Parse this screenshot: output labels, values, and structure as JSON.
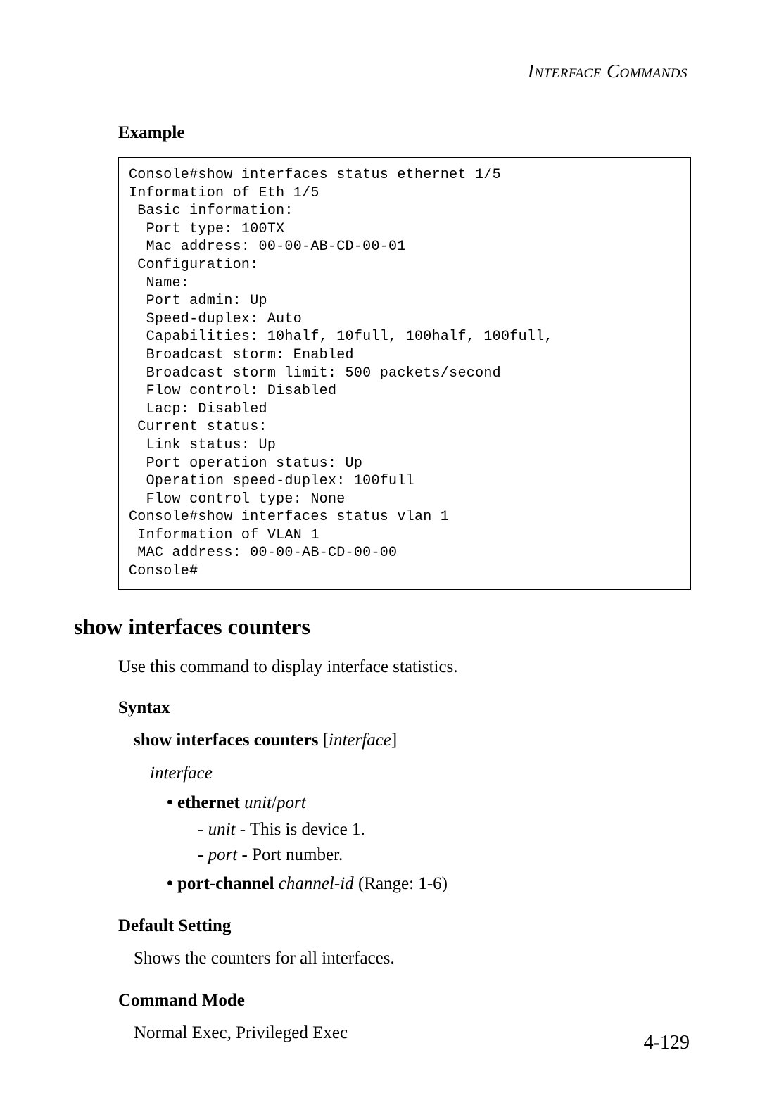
{
  "running_head": "Interface Commands",
  "example_heading": "Example",
  "console_output": "Console#show interfaces status ethernet 1/5\nInformation of Eth 1/5\n Basic information:\n  Port type: 100TX\n  Mac address: 00-00-AB-CD-00-01\n Configuration:\n  Name:\n  Port admin: Up\n  Speed-duplex: Auto\n  Capabilities: 10half, 10full, 100half, 100full,\n  Broadcast storm: Enabled\n  Broadcast storm limit: 500 packets/second\n  Flow control: Disabled\n  Lacp: Disabled\n Current status:\n  Link status: Up\n  Port operation status: Up\n  Operation speed-duplex: 100full\n  Flow control type: None\nConsole#show interfaces status vlan 1\n Information of VLAN 1\n MAC address: 00-00-AB-CD-00-00\nConsole#",
  "section_title": "show interfaces counters",
  "description": "Use this command to display interface statistics.",
  "syntax_heading": "Syntax",
  "syntax": {
    "cmd_bold": "show interfaces counters",
    "open_bracket": " [",
    "param_italic": "interface",
    "close_bracket": "]",
    "interface_label": "interface",
    "ethernet": {
      "kw": "ethernet",
      "args": "unit",
      "slash": "/",
      "args2": "port",
      "unit_label": "unit",
      "unit_desc": " - This is device 1.",
      "port_label": "port",
      "port_desc": " - Port number."
    },
    "portchannel": {
      "kw": "port-channel",
      "arg": "channel-id",
      "rest": " (Range: 1-6)"
    }
  },
  "default_heading": "Default Setting",
  "default_text": "Shows the counters for all interfaces.",
  "mode_heading": "Command Mode",
  "mode_text": "Normal Exec, Privileged Exec",
  "page_number": "4-129"
}
